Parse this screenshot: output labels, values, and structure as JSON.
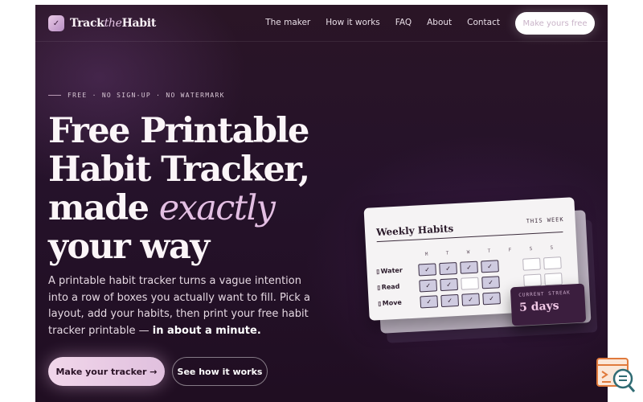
{
  "brand": {
    "mark": "✓",
    "name_part1": "Track",
    "name_part2": "the",
    "name_part3": "Habit"
  },
  "nav": {
    "links": [
      "The maker",
      "How it works",
      "FAQ",
      "About",
      "Contact"
    ],
    "cta": "Make yours free"
  },
  "hero": {
    "eyebrow": "FREE · NO SIGN-UP · NO WATERMARK",
    "headline_line1": "Free Printable",
    "headline_line2": "Habit Tracker,",
    "headline_made": "made ",
    "headline_accent": "exactly",
    "headline_line4": "your way",
    "lede": "A printable habit tracker turns a vague intention into a row of boxes you actually want to fill. Pick a layout, add your habits, then print your free habit tracker printable — ",
    "lede_strong": "in about a minute.",
    "primary_button": "Make your tracker →",
    "secondary_button": "See how it works"
  },
  "tracker": {
    "title": "Weekly Habits",
    "week_label": "THIS WEEK",
    "days": [
      "M",
      "T",
      "W",
      "T",
      "F",
      "S",
      "S"
    ],
    "habits": [
      {
        "name": "Water",
        "done": [
          true,
          true,
          true,
          true,
          false,
          false,
          false
        ]
      },
      {
        "name": "Read",
        "done": [
          true,
          true,
          false,
          true,
          false,
          false,
          false
        ]
      },
      {
        "name": "Move",
        "done": [
          true,
          true,
          true,
          true,
          false,
          false,
          false
        ]
      }
    ],
    "check_glyph": "✓",
    "streak_label": "CURRENT STREAK",
    "streak_value": "5 days"
  },
  "colors": {
    "background": "#25122a",
    "accent": "#e3bfe3",
    "widget": "#e07a3c"
  },
  "widget": {
    "icon": "chat-search-icon"
  }
}
